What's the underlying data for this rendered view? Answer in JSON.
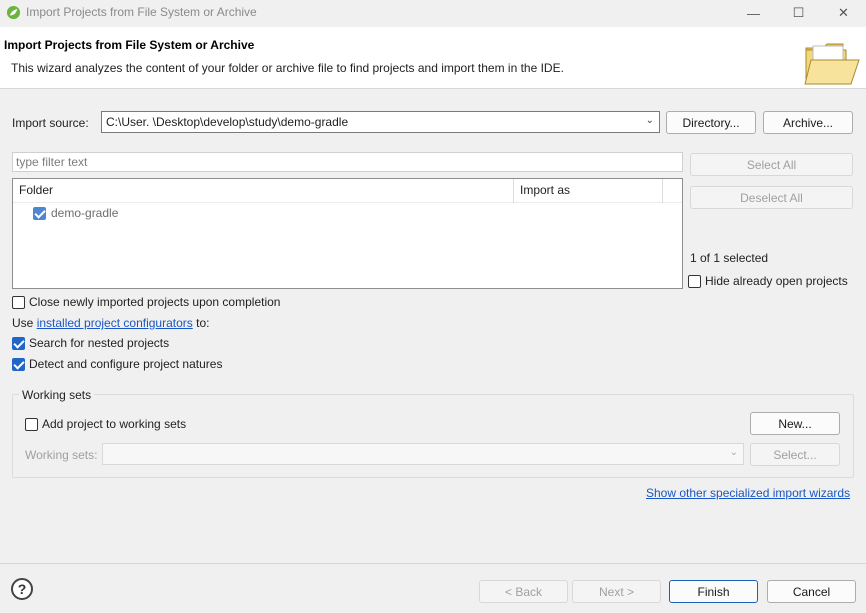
{
  "window": {
    "title": "Import Projects from File System or Archive",
    "minimize_glyph": "—",
    "maximize_glyph": "☐",
    "close_glyph": "✕"
  },
  "header": {
    "title": "Import Projects from File System or Archive",
    "description": "This wizard analyzes the content of your folder or archive file to find projects and import them in the IDE."
  },
  "import_source": {
    "label": "Import source:",
    "value": "C:\\User.              \\Desktop\\develop\\study\\demo-gradle",
    "directory_button": "Directory...",
    "archive_button": "Archive..."
  },
  "filter": {
    "placeholder": "type filter text"
  },
  "table": {
    "columns": [
      "Folder",
      "Import as"
    ],
    "rows": [
      {
        "folder": "demo-gradle",
        "import_as": "",
        "checked": true
      }
    ]
  },
  "side": {
    "select_all": "Select All",
    "deselect_all": "Deselect All",
    "selection_status": "1 of 1 selected",
    "hide_open_label": "Hide already open projects",
    "hide_open_checked": false
  },
  "options": {
    "close_after_label": "Close newly imported projects upon completion",
    "close_after_checked": false,
    "use_prefix": "Use",
    "configurators_link": "installed project configurators",
    "use_suffix": "to:",
    "nested_label": "Search for nested projects",
    "nested_checked": true,
    "natures_label": "Detect and configure project natures",
    "natures_checked": true
  },
  "working_sets": {
    "group_title": "Working sets",
    "add_label": "Add project to working sets",
    "add_checked": false,
    "new_button": "New...",
    "sets_label": "Working sets:",
    "select_button": "Select..."
  },
  "specialized_link": "Show other specialized import wizards",
  "footer": {
    "help_glyph": "?",
    "back": "< Back",
    "next": "Next >",
    "finish": "Finish",
    "cancel": "Cancel"
  },
  "colors": {
    "accent": "#1f66c8",
    "link": "#1a56c4",
    "header_bg": "#ffffff",
    "dialog_bg": "#f0f0f0"
  }
}
